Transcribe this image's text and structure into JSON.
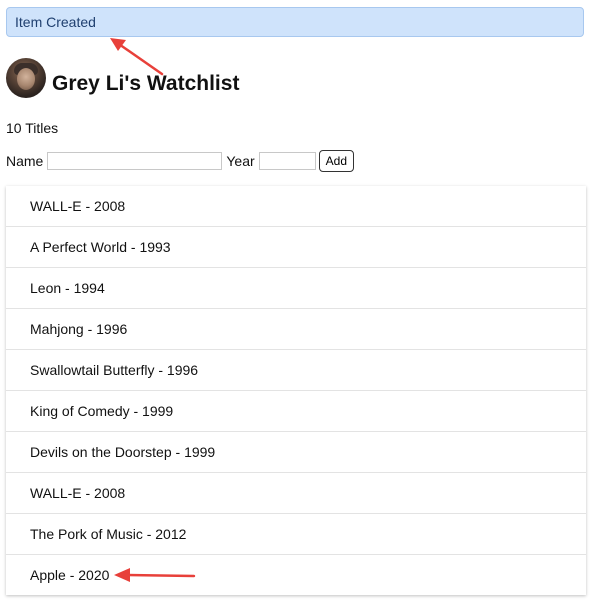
{
  "alert": {
    "message": "Item Created"
  },
  "header": {
    "title": "Grey Li's Watchlist",
    "avatar_icon": "avatar-photo"
  },
  "summary": {
    "count_text": "10 Titles"
  },
  "form": {
    "name_label": "Name",
    "name_value": "",
    "year_label": "Year",
    "year_value": "",
    "add_label": "Add"
  },
  "movies": [
    {
      "text": "WALL-E - 2008"
    },
    {
      "text": "A Perfect World - 1993"
    },
    {
      "text": "Leon - 1994"
    },
    {
      "text": "Mahjong - 1996"
    },
    {
      "text": "Swallowtail Butterfly - 1996"
    },
    {
      "text": "King of Comedy - 1999"
    },
    {
      "text": "Devils on the Doorstep - 1999"
    },
    {
      "text": "WALL-E - 2008"
    },
    {
      "text": "The Pork of Music - 2012"
    },
    {
      "text": "Apple - 2020"
    }
  ],
  "colors": {
    "alert_bg": "#cfe3fb",
    "alert_text": "#1f3f6f",
    "annotation_arrow": "#e8403a"
  }
}
